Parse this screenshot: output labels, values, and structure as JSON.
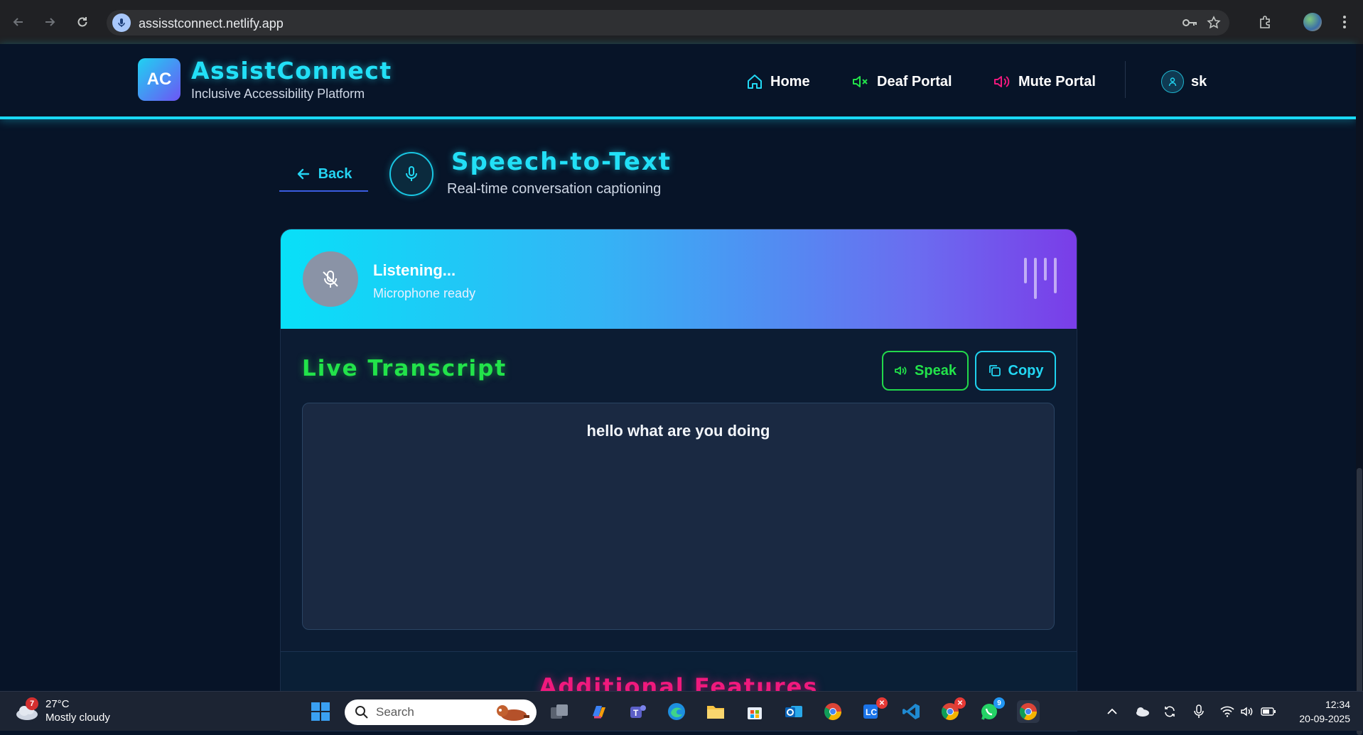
{
  "browser": {
    "url": "assisstconnect.netlify.app"
  },
  "header": {
    "logo_text": "AC",
    "brand_title": "AssistConnect",
    "brand_subtitle": "Inclusive Accessibility Platform",
    "nav": [
      {
        "label": "Home",
        "icon": "home-icon",
        "color": "#22d8f4"
      },
      {
        "label": "Deaf Portal",
        "icon": "speaker-muted-icon",
        "color": "#22e34a"
      },
      {
        "label": "Mute Portal",
        "icon": "speaker-icon",
        "color": "#f0197d"
      }
    ],
    "user_name": "sk"
  },
  "page": {
    "back_label": "Back",
    "title": "Speech-to-Text",
    "subtitle": "Real-time conversation captioning"
  },
  "status": {
    "title": "Listening...",
    "subtitle": "Microphone ready"
  },
  "transcript": {
    "heading": "Live Transcript",
    "speak_label": "Speak",
    "copy_label": "Copy",
    "text": "hello what are you doing"
  },
  "features": {
    "heading": "Additional Features"
  },
  "taskbar": {
    "weather_badge": "7",
    "temperature": "27°C",
    "condition": "Mostly cloudy",
    "search_placeholder": "Search",
    "whatsapp_badge": "9",
    "time": "12:34",
    "date": "20-09-2025"
  },
  "colors": {
    "accent_cyan": "#22e0f7",
    "accent_green": "#22e34a",
    "accent_pink": "#f0197d",
    "background": "#071428"
  }
}
